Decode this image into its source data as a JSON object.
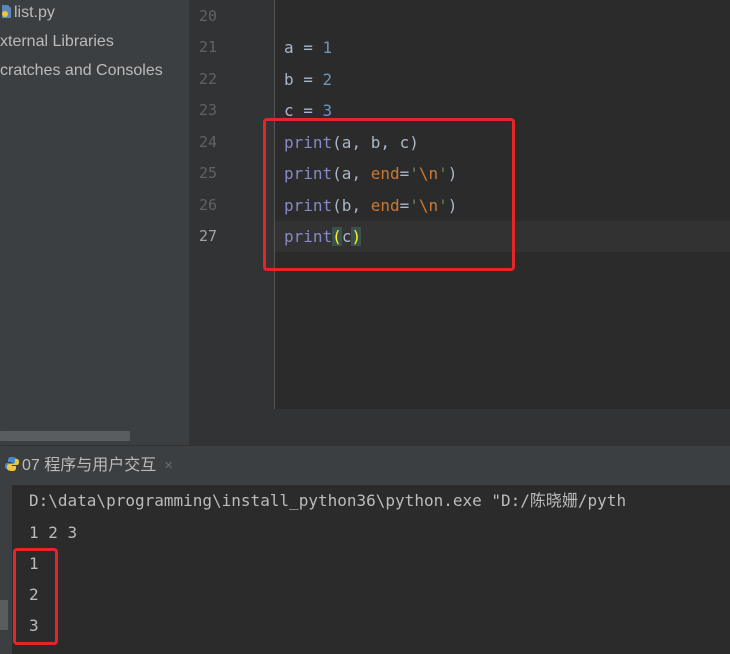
{
  "project_tree": {
    "items": [
      {
        "label": "list.py",
        "icon": "python-file-icon"
      },
      {
        "label": "xternal Libraries"
      },
      {
        "label": "cratches and Consoles"
      }
    ]
  },
  "editor": {
    "line_numbers": [
      "20",
      "21",
      "22",
      "23",
      "24",
      "25",
      "26",
      "27"
    ],
    "active_line": "27",
    "code": {
      "l21": {
        "var": "a",
        "op": " = ",
        "val": "1"
      },
      "l22": {
        "var": "b",
        "op": " = ",
        "val": "2"
      },
      "l23": {
        "var": "c",
        "op": " = ",
        "val": "3"
      },
      "l24": {
        "fn": "print",
        "args": "(a, b, c)"
      },
      "l25": {
        "fn": "print",
        "pre": "(a, ",
        "kw": "end",
        "eq": "=",
        "q1": "'",
        "esc": "\\n",
        "q2": "'",
        "post": ")"
      },
      "l26": {
        "fn": "print",
        "pre": "(b, ",
        "kw": "end",
        "eq": "=",
        "q1": "'",
        "esc": "\\n",
        "q2": "'",
        "post": ")"
      },
      "l27": {
        "fn": "print",
        "open": "(",
        "arg": "c",
        "close": ")"
      }
    }
  },
  "run_panel": {
    "tab_label": "07 程序与用户交互",
    "tab_icon": "python-icon",
    "close_glyph": "×",
    "console_lines": [
      "D:\\data\\programming\\install_python36\\python.exe \"D:/陈晓姗/pyth",
      "1 2 3",
      "1",
      "2",
      "3"
    ]
  },
  "colors": {
    "highlight_box": "#e4262b",
    "keyword": "#cc7832",
    "number": "#6897bb",
    "string": "#6a8759",
    "builtin": "#8888c6"
  }
}
